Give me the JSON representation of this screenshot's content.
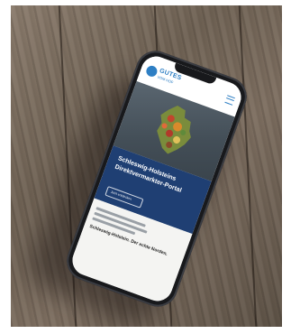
{
  "scene": {
    "description_colors": {
      "wood": "#6f6254",
      "phone_body": "#18191c",
      "banner_blue": "#1f3f73",
      "brand_blue": "#2e7fc4"
    }
  },
  "phone_screen": {
    "brand_name": "GUTES",
    "brand_tagline": "VOM HOF",
    "banner_lines": [
      "Schleswig-Holsteins",
      "Direktvermarkter-Portal"
    ],
    "banner_button": "Jetzt entdecken",
    "body_headline": "Schleswig-Holstein. Der echte Norden."
  }
}
